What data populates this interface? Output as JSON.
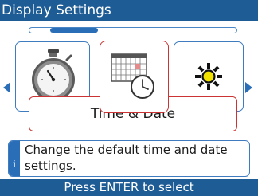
{
  "header": {
    "title": "Display Settings"
  },
  "carousel": {
    "items": [
      {
        "icon": "stopwatch-icon"
      },
      {
        "icon": "calendar-clock-icon",
        "selected": true
      },
      {
        "icon": "brightness-sun-icon"
      }
    ],
    "selected_label": "Time & Date",
    "scroll_position": 0.15
  },
  "description": {
    "info_icon": "i",
    "text": "Change the default time and date settings."
  },
  "footer": {
    "hint": "Press ENTER to select"
  },
  "colors": {
    "bar": "#1e5c96",
    "accent": "#2b6eb8",
    "selected_border": "#cc3333"
  }
}
